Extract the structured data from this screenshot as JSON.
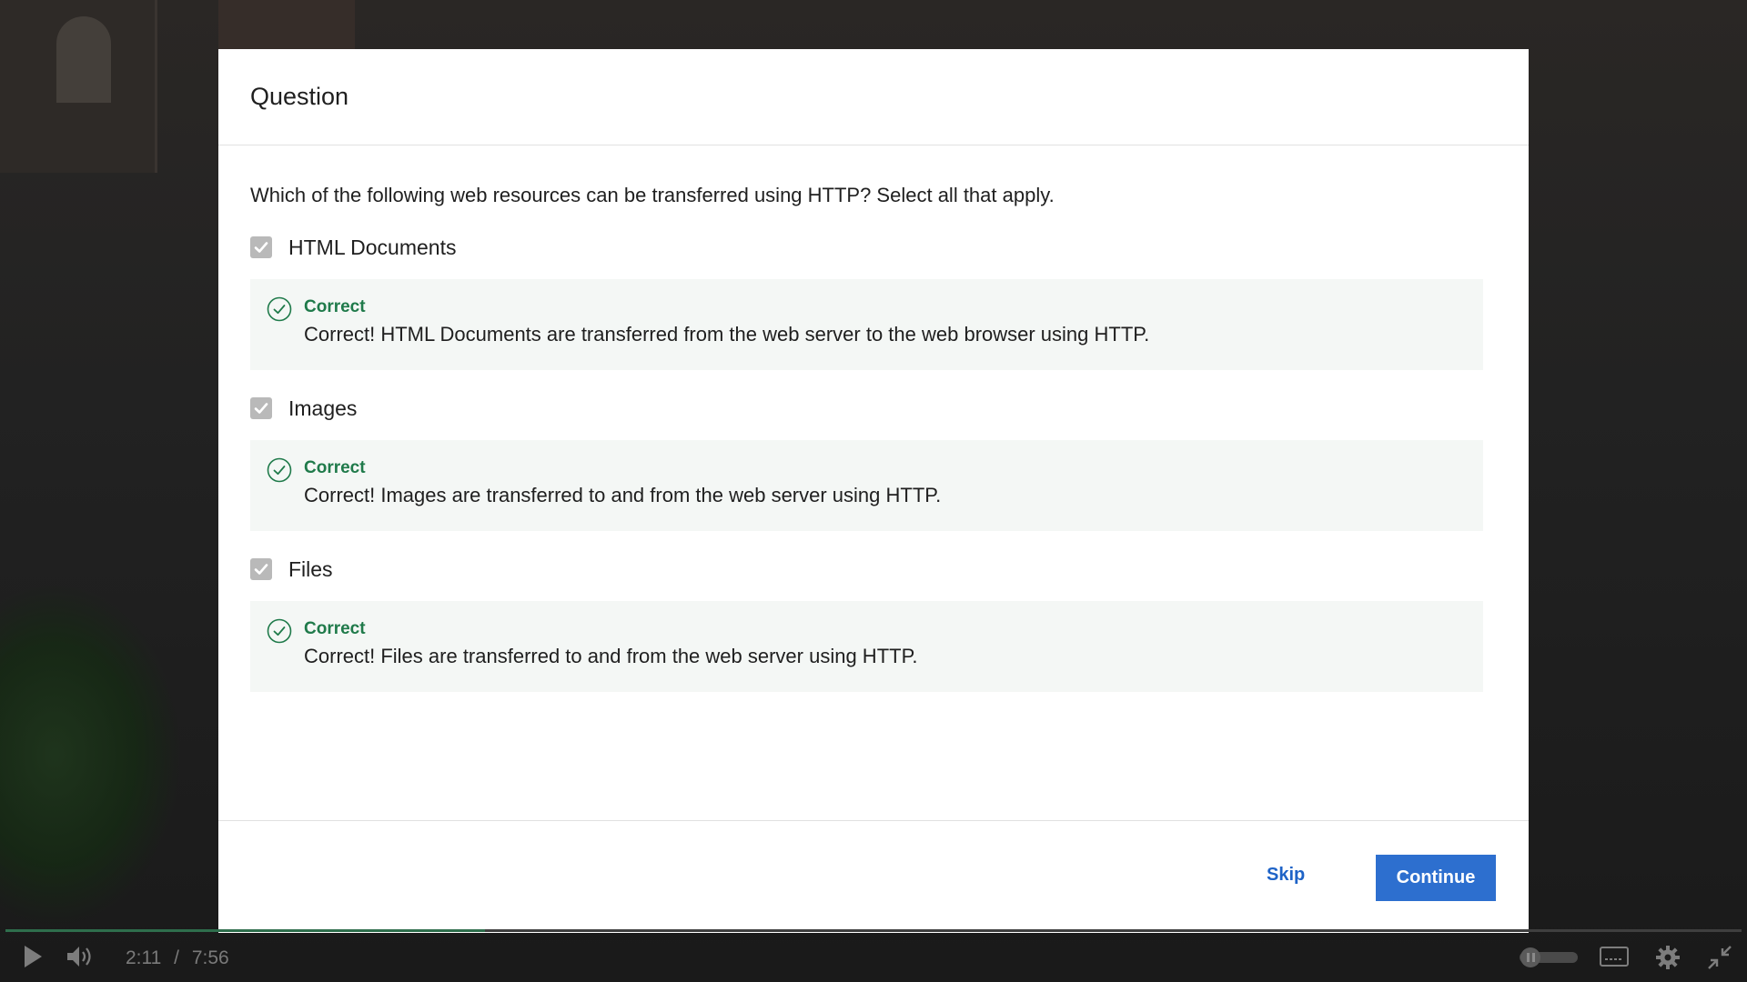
{
  "question": {
    "title": "Question",
    "prompt": "Which of the following web resources can be transferred using HTTP? Select all that apply.",
    "options": [
      {
        "label": "HTML Documents",
        "checked": true,
        "feedback_title": "Correct",
        "feedback_text": "Correct! HTML Documents are transferred from the web server to the web browser using HTTP."
      },
      {
        "label": "Images",
        "checked": true,
        "feedback_title": "Correct",
        "feedback_text": "Correct! Images are transferred to and from the web server using HTTP."
      },
      {
        "label": "Files",
        "checked": true,
        "feedback_title": "Correct",
        "feedback_text": "Correct! Files are transferred to and from the web server using HTTP."
      }
    ]
  },
  "footer": {
    "skip_label": "Skip",
    "continue_label": "Continue"
  },
  "player": {
    "current_time": "2:11",
    "separator": "/",
    "duration": "7:56",
    "progress_fraction": 0.276,
    "icons": [
      "play-icon",
      "volume-icon",
      "toggle-icon",
      "captions-icon",
      "settings-icon",
      "exit-fullscreen-icon"
    ]
  },
  "colors": {
    "correct": "#1f7a4a",
    "accent": "#2d6fcf",
    "link": "#1e63c7",
    "feedback_bg": "#f4f7f5",
    "checkbox": "#b9b9b9"
  }
}
